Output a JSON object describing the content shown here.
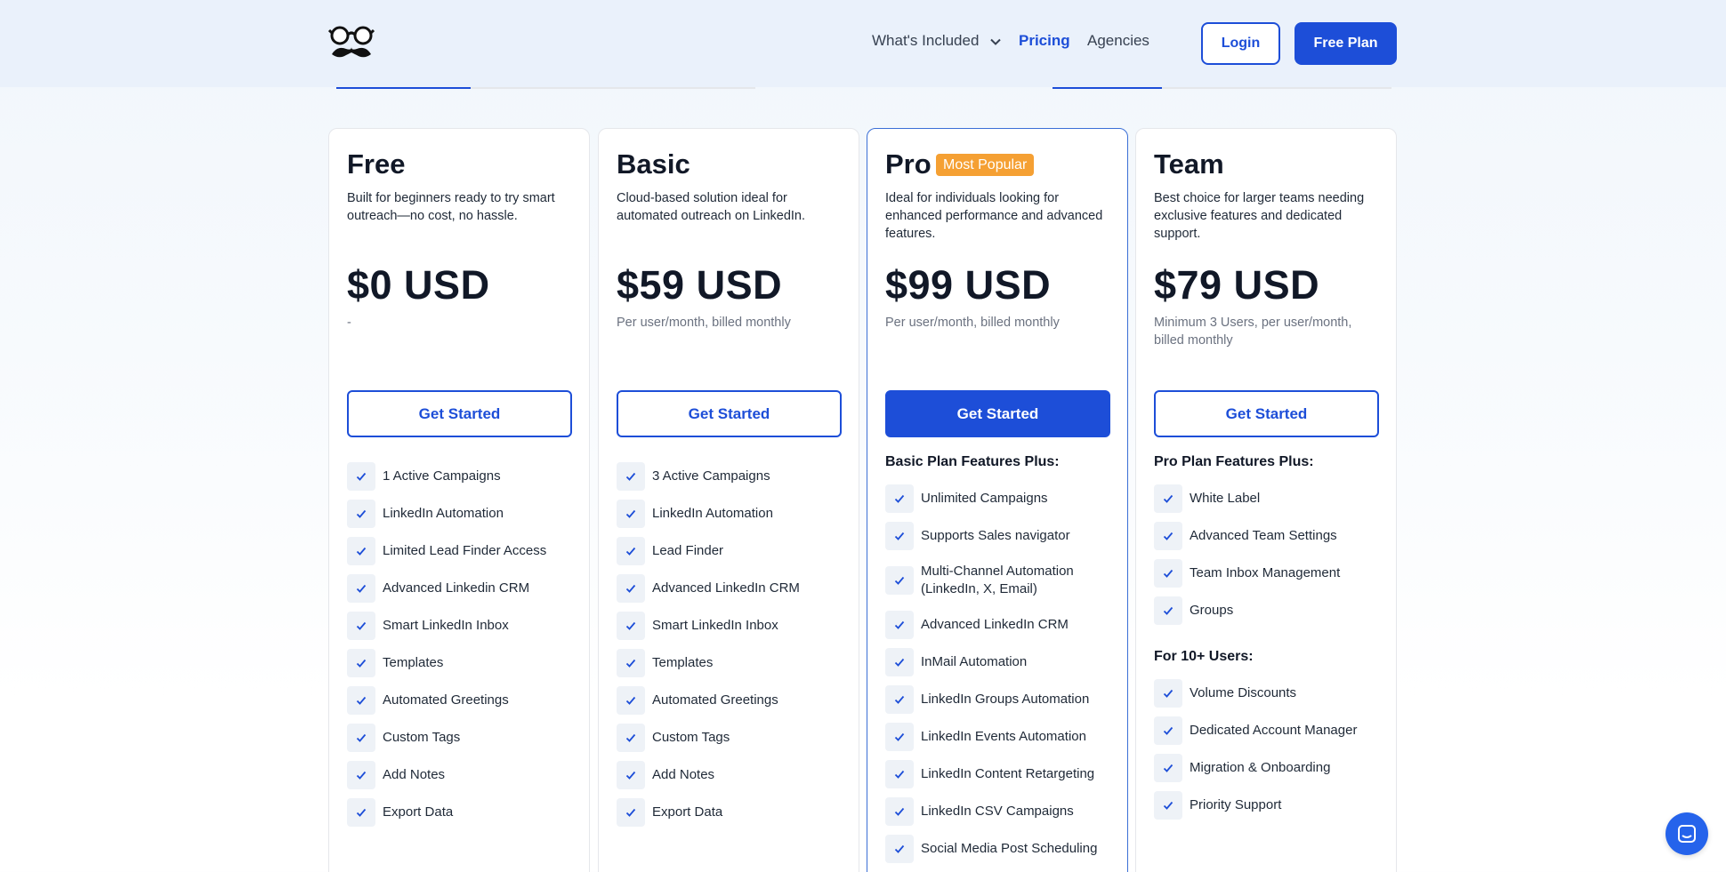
{
  "header": {
    "logo_icon": "glasses-mustache-logo",
    "nav": {
      "whats_included": "What's Included",
      "pricing": "Pricing",
      "agencies": "Agencies"
    },
    "login": "Login",
    "free_plan": "Free Plan"
  },
  "colors": {
    "accent": "#1d4ed8",
    "badge": "#f5a033"
  },
  "plans": [
    {
      "name": "Free",
      "description": "Built for beginners ready to try smart outreach—no cost, no hassle.",
      "price": "$0 USD",
      "note": "-",
      "cta": "Get Started",
      "features": [
        "1 Active Campaigns",
        "LinkedIn Automation",
        "Limited Lead Finder Access",
        "Advanced Linkedin CRM",
        "Smart LinkedIn Inbox",
        "Templates",
        "Automated Greetings",
        "Custom Tags",
        "Add Notes",
        "Export Data"
      ]
    },
    {
      "name": "Basic",
      "description": "Cloud-based solution ideal for automated outreach on LinkedIn.",
      "price": "$59 USD",
      "note": "Per user/month, billed monthly",
      "cta": "Get Started",
      "features": [
        "3 Active Campaigns",
        "LinkedIn Automation",
        "Lead Finder",
        "Advanced LinkedIn CRM",
        "Smart LinkedIn Inbox",
        "Templates",
        "Automated Greetings",
        "Custom Tags",
        "Add Notes",
        "Export Data"
      ]
    },
    {
      "name": "Pro",
      "badge": "Most Popular",
      "description": "Ideal for individuals looking for enhanced performance and advanced features.",
      "price": "$99 USD",
      "note": "Per user/month, billed monthly",
      "cta": "Get Started",
      "features_heading": "Basic Plan Features Plus:",
      "features": [
        "Unlimited Campaigns",
        "Supports Sales navigator",
        "Multi-Channel Automation (LinkedIn, X, Email)",
        "Advanced LinkedIn CRM",
        "InMail Automation",
        "LinkedIn Groups Automation",
        "LinkedIn Events Automation",
        "LinkedIn Content Retargeting",
        "LinkedIn CSV Campaigns",
        "Social Media Post Scheduling"
      ]
    },
    {
      "name": "Team",
      "description": "Best choice for larger teams needing exclusive features and dedicated support.",
      "price": "$79 USD",
      "note": "Minimum 3 Users, per user/month, billed monthly",
      "cta": "Get Started",
      "features_heading": "Pro Plan Features Plus:",
      "features": [
        "White Label",
        "Advanced Team Settings",
        "Team Inbox Management",
        "Groups"
      ],
      "features_heading_2": "For 10+ Users:",
      "features_2": [
        "Volume Discounts",
        "Dedicated Account Manager",
        "Migration & Onboarding",
        "Priority Support"
      ]
    }
  ],
  "chat_icon": "chat-widget-icon"
}
